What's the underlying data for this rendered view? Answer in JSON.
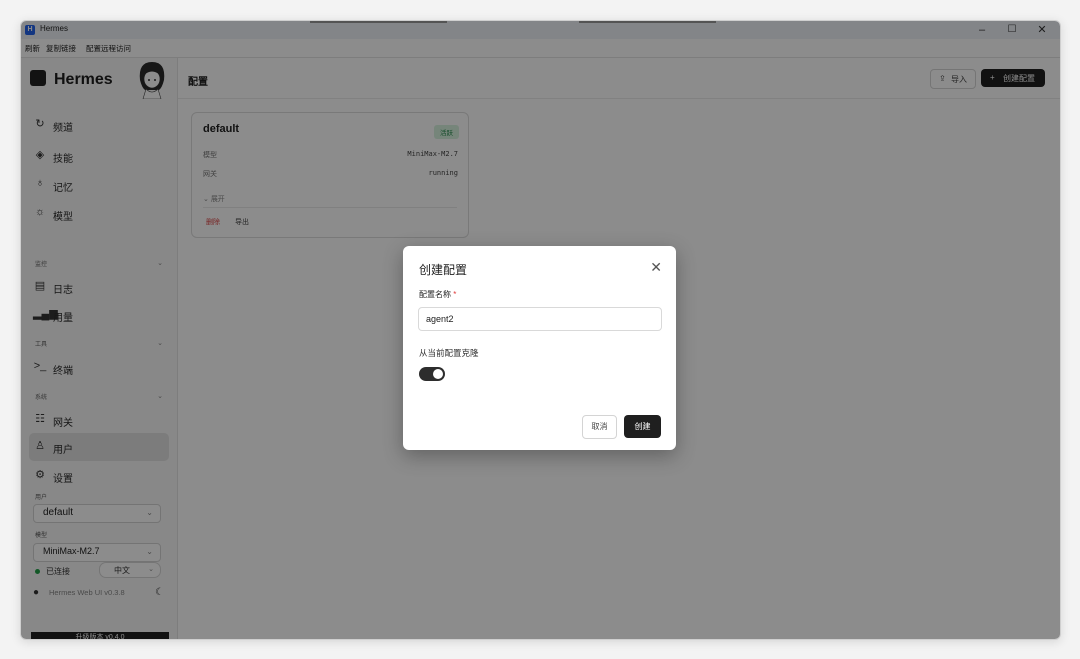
{
  "window": {
    "title": "Hermes",
    "controls": {
      "minimize": "–",
      "maximize": "☐",
      "close": "✕"
    }
  },
  "menu": [
    "刷新",
    "复制链接",
    "配置远程访问"
  ],
  "sidebar": {
    "app_name": "Hermes",
    "nav_top": [
      {
        "label": "频道",
        "icon": "refresh-icon"
      },
      {
        "label": "技能",
        "icon": "layers-icon"
      },
      {
        "label": "记忆",
        "icon": "bulb-icon"
      },
      {
        "label": "模型",
        "icon": "sun-icon"
      }
    ],
    "section_monitor": "监控",
    "nav_monitor": [
      {
        "label": "日志",
        "icon": "file-icon"
      },
      {
        "label": "用量",
        "icon": "bar-chart-icon"
      }
    ],
    "section_tools": "工具",
    "nav_tools": [
      {
        "label": "终端",
        "icon": "terminal-icon"
      }
    ],
    "section_system": "系统",
    "nav_system": [
      {
        "label": "网关",
        "icon": "server-icon"
      },
      {
        "label": "用户",
        "icon": "user-icon",
        "active": true
      },
      {
        "label": "设置",
        "icon": "gear-icon"
      }
    ],
    "user_label": "用户",
    "user_value": "default",
    "model_label": "模型",
    "model_value": "MiniMax-M2.7",
    "status": "已连接",
    "language": "中文",
    "version": "Hermes Web UI v0.3.8",
    "upgrade": "升级版本 v0.4.0"
  },
  "main": {
    "title": "配置",
    "import_label": "导入",
    "create_label": "创建配置",
    "card": {
      "name": "default",
      "badge": "活跃",
      "model_key": "模型",
      "model_value": "MiniMax-M2.7",
      "gateway_key": "网关",
      "gateway_value": "running",
      "expand": "展开",
      "delete": "删除",
      "export": "导出"
    }
  },
  "modal": {
    "title": "创建配置",
    "name_label": "配置名称",
    "required_mark": "*",
    "name_value": "agent2",
    "clone_label": "从当前配置克隆",
    "clone_enabled": true,
    "cancel": "取消",
    "confirm": "创建"
  },
  "colors": {
    "accent": "#1f1f1f",
    "status_green": "#21a047",
    "danger": "#d94242",
    "badge_bg": "#d7f3df"
  }
}
